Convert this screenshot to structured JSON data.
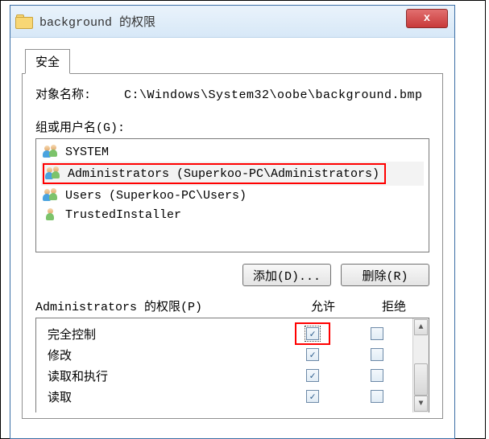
{
  "window": {
    "title": "background 的权限",
    "close_label": "x"
  },
  "tabs": {
    "security": "安全"
  },
  "object": {
    "label": "对象名称:",
    "path": "C:\\Windows\\System32\\oobe\\background.bmp"
  },
  "groups": {
    "label": "组或用户名(G):",
    "items": [
      {
        "name": "SYSTEM",
        "highlighted": false
      },
      {
        "name": "Administrators (Superkoo-PC\\Administrators)",
        "highlighted": true
      },
      {
        "name": "Users (Superkoo-PC\\Users)",
        "highlighted": false
      },
      {
        "name": "TrustedInstaller",
        "highlighted": false
      }
    ]
  },
  "buttons": {
    "add": "添加(D)...",
    "remove": "删除(R)"
  },
  "permissions": {
    "header_for_label": "Administrators 的权限(P)",
    "allow_label": "允许",
    "deny_label": "拒绝",
    "rows": [
      {
        "label": "完全控制",
        "allow": true,
        "deny": false,
        "highlight_allow": true
      },
      {
        "label": "修改",
        "allow": true,
        "deny": false
      },
      {
        "label": "读取和执行",
        "allow": true,
        "deny": false
      },
      {
        "label": "读取",
        "allow": true,
        "deny": false
      }
    ]
  }
}
